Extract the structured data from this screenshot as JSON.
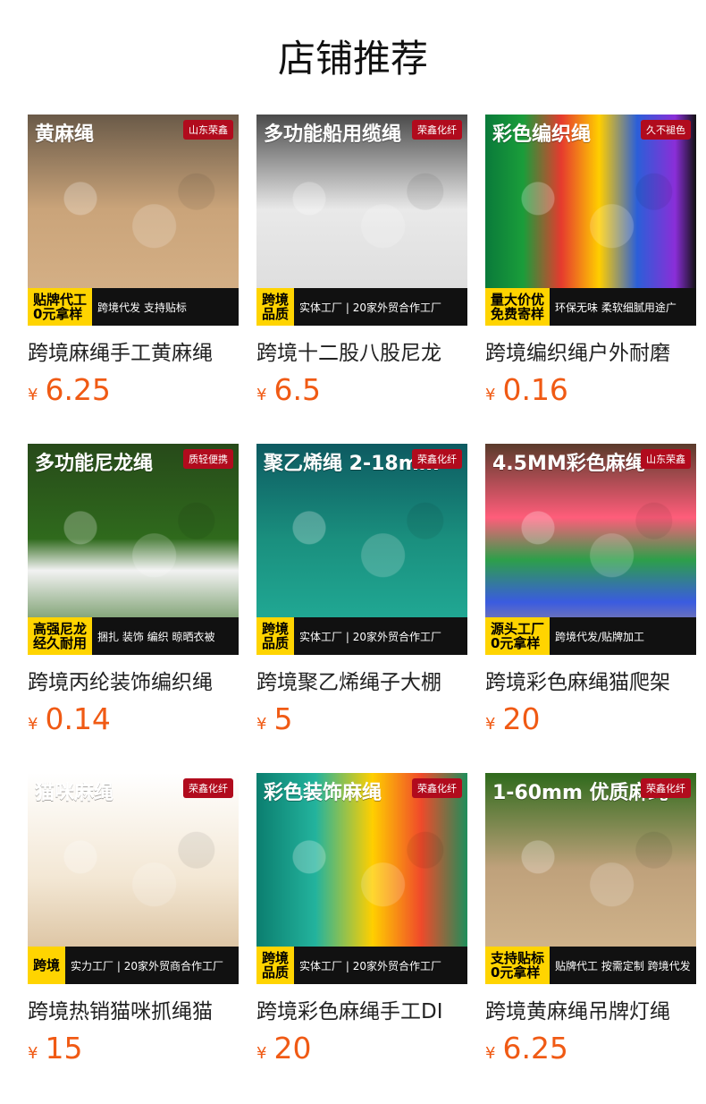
{
  "page": {
    "title": "店铺推荐"
  },
  "products": [
    {
      "name": "跨境麻绳手工黄麻绳",
      "currency": "¥",
      "price": "6.25",
      "theme": "t-jute",
      "thumb": {
        "banner": "黄麻绳",
        "badge": "山东荣鑫",
        "footer_left": "贴牌代工\n0元拿样",
        "footer_right": "跨境代发 支持贴标"
      }
    },
    {
      "name": "跨境十二股八股尼龙",
      "currency": "¥",
      "price": "6.5",
      "theme": "t-white",
      "thumb": {
        "banner": "多功能船用缆绳",
        "badge": "荣鑫化纤",
        "footer_left": "跨境\n品质",
        "footer_right": "实体工厂 | 20家外贸合作工厂"
      }
    },
    {
      "name": "跨境编织绳户外耐磨",
      "currency": "¥",
      "price": "0.16",
      "theme": "t-color",
      "thumb": {
        "banner": "彩色编织绳",
        "badge": "久不褪色",
        "footer_left": "量大价优\n免费寄样",
        "footer_right": "环保无味 柔软细腻用途广"
      }
    },
    {
      "name": "跨境丙纶装饰编织绳",
      "currency": "¥",
      "price": "0.14",
      "theme": "t-nylon",
      "thumb": {
        "banner": "多功能尼龙绳",
        "badge": "质轻便携",
        "footer_left": "高强尼龙\n经久耐用",
        "footer_right": "捆扎 装饰 编织 晾晒衣被"
      }
    },
    {
      "name": "跨境聚乙烯绳子大棚",
      "currency": "¥",
      "price": "5",
      "theme": "t-pe",
      "thumb": {
        "banner": "聚乙烯绳 2-18mm",
        "badge": "荣鑫化纤",
        "footer_left": "跨境\n品质",
        "footer_right": "实体工厂 | 20家外贸合作工厂"
      }
    },
    {
      "name": "跨境彩色麻绳猫爬架",
      "currency": "¥",
      "price": "20",
      "theme": "t-tri",
      "thumb": {
        "banner": "4.5MM彩色麻绳",
        "badge": "山东荣鑫",
        "footer_left": "源头工厂\n0元拿样",
        "footer_right": "跨境代发/贴牌加工"
      }
    },
    {
      "name": "跨境热销猫咪抓绳猫",
      "currency": "¥",
      "price": "15",
      "theme": "t-cat",
      "thumb": {
        "banner": "猫咪麻绳",
        "badge": "荣鑫化纤",
        "footer_left": "跨境",
        "footer_right": "实力工厂 | 20家外贸商合作工厂"
      }
    },
    {
      "name": "跨境彩色麻绳手工DI",
      "currency": "¥",
      "price": "20",
      "theme": "t-colored",
      "thumb": {
        "banner": "彩色装饰麻绳",
        "badge": "荣鑫化纤",
        "footer_left": "跨境\n品质",
        "footer_right": "实体工厂 | 20家外贸合作工厂"
      }
    },
    {
      "name": "跨境黄麻绳吊牌灯绳",
      "currency": "¥",
      "price": "6.25",
      "theme": "t-hang",
      "thumb": {
        "banner": "1-60mm 优质麻绳",
        "badge": "荣鑫化纤",
        "footer_left": "支持贴标\n0元拿样",
        "footer_right": "贴牌代工 按需定制 跨境代发"
      }
    }
  ]
}
